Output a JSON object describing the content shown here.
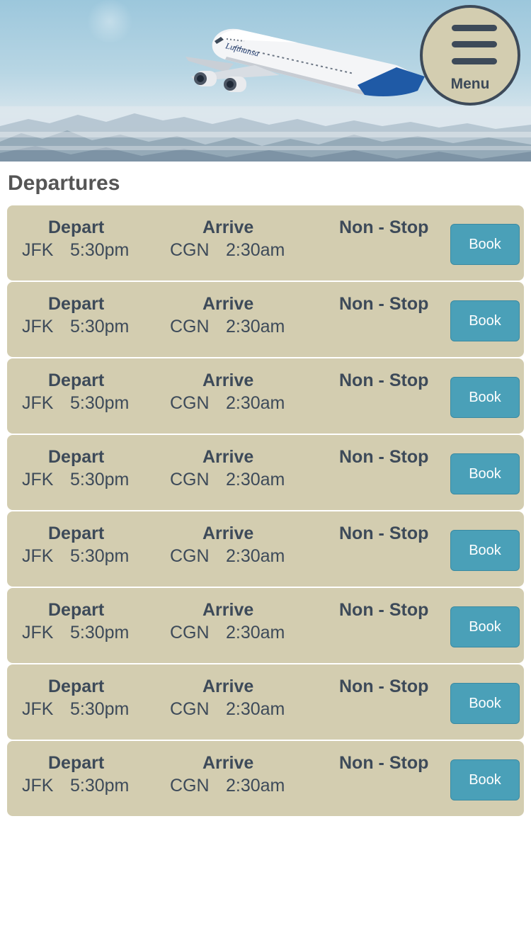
{
  "header": {
    "menu_label": "Menu",
    "airline_livery": "Lufthansa"
  },
  "section": {
    "title": "Departures"
  },
  "colors": {
    "card": "#d3cdb0",
    "text": "#3d4a59",
    "book_button": "#4aa0b8",
    "title": "#555555"
  },
  "flights": [
    {
      "depart_label": "Depart",
      "arrive_label": "Arrive",
      "stops": "Non - Stop",
      "depart_code": "JFK",
      "depart_time": "5:30pm",
      "arrive_code": "CGN",
      "arrive_time": "2:30am",
      "book_label": "Book"
    },
    {
      "depart_label": "Depart",
      "arrive_label": "Arrive",
      "stops": "Non - Stop",
      "depart_code": "JFK",
      "depart_time": "5:30pm",
      "arrive_code": "CGN",
      "arrive_time": "2:30am",
      "book_label": "Book"
    },
    {
      "depart_label": "Depart",
      "arrive_label": "Arrive",
      "stops": "Non - Stop",
      "depart_code": "JFK",
      "depart_time": "5:30pm",
      "arrive_code": "CGN",
      "arrive_time": "2:30am",
      "book_label": "Book"
    },
    {
      "depart_label": "Depart",
      "arrive_label": "Arrive",
      "stops": "Non - Stop",
      "depart_code": "JFK",
      "depart_time": "5:30pm",
      "arrive_code": "CGN",
      "arrive_time": "2:30am",
      "book_label": "Book"
    },
    {
      "depart_label": "Depart",
      "arrive_label": "Arrive",
      "stops": "Non - Stop",
      "depart_code": "JFK",
      "depart_time": "5:30pm",
      "arrive_code": "CGN",
      "arrive_time": "2:30am",
      "book_label": "Book"
    },
    {
      "depart_label": "Depart",
      "arrive_label": "Arrive",
      "stops": "Non - Stop",
      "depart_code": "JFK",
      "depart_time": "5:30pm",
      "arrive_code": "CGN",
      "arrive_time": "2:30am",
      "book_label": "Book"
    },
    {
      "depart_label": "Depart",
      "arrive_label": "Arrive",
      "stops": "Non - Stop",
      "depart_code": "JFK",
      "depart_time": "5:30pm",
      "arrive_code": "CGN",
      "arrive_time": "2:30am",
      "book_label": "Book"
    },
    {
      "depart_label": "Depart",
      "arrive_label": "Arrive",
      "stops": "Non - Stop",
      "depart_code": "JFK",
      "depart_time": "5:30pm",
      "arrive_code": "CGN",
      "arrive_time": "2:30am",
      "book_label": "Book"
    }
  ]
}
